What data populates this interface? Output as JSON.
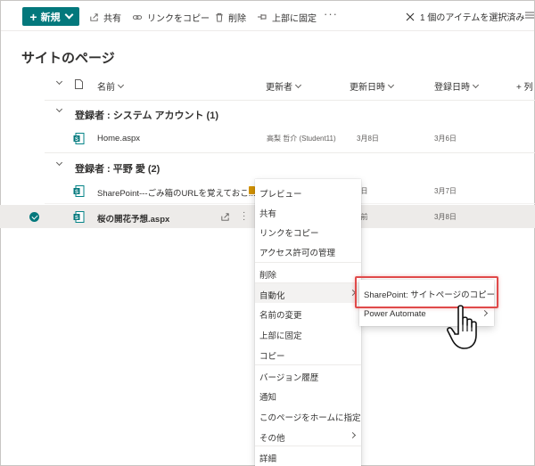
{
  "toolbar": {
    "new_label": "新規",
    "share_label": "共有",
    "copy_link_label": "リンクをコピー",
    "delete_label": "削除",
    "pin_label": "上部に固定",
    "more_label": "···",
    "selection_label": "1 個のアイテムを選択済み"
  },
  "page_title": "サイトのページ",
  "columns": {
    "name": "名前",
    "modified_by": "更新者",
    "modified": "更新日時",
    "created": "登録日時",
    "add_column": "+ 列"
  },
  "groups": [
    {
      "label": "登録者 : システム アカウント (1)",
      "rows": [
        {
          "name": "Home.aspx",
          "modified_by": "高梨 哲介 (Student11)",
          "modified": "3月8日",
          "created": "3月6日"
        }
      ]
    },
    {
      "label": "登録者 : 平野 愛 (2)",
      "rows": [
        {
          "name": "SharePoint---ごみ箱のURLを覚えておこ...",
          "modified_by": "",
          "modified": "7日",
          "created": "3月7日"
        },
        {
          "name": "桜の開花予想.aspx",
          "modified_by": "",
          "modified": "8前",
          "created": "3月8日"
        }
      ]
    }
  ],
  "context_menu": {
    "items": [
      "プレビュー",
      "共有",
      "リンクをコピー",
      "アクセス許可の管理",
      "削除",
      "自動化",
      "名前の変更",
      "上部に固定",
      "コピー",
      "バージョン履歴",
      "通知",
      "このページをホームに指定",
      "その他",
      "詳細"
    ]
  },
  "submenu": {
    "items": [
      "SharePoint: サイトページのコピー",
      "Power Automate"
    ]
  },
  "colors": {
    "accent": "#03787c",
    "highlight": "#e04a4a"
  }
}
